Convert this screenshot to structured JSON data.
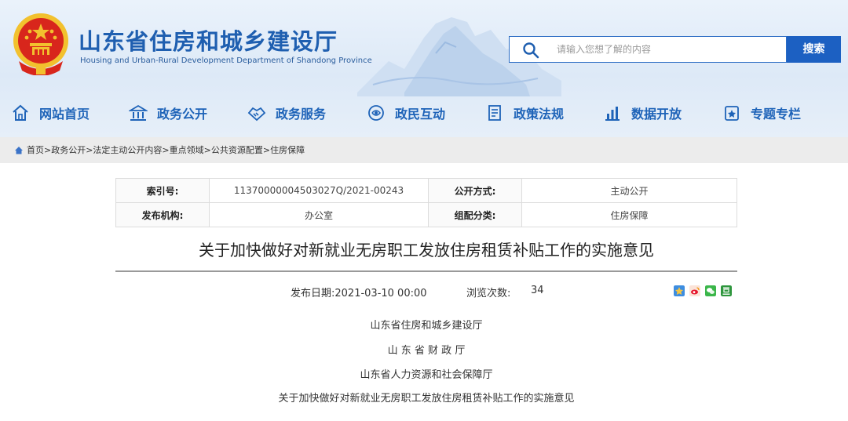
{
  "site": {
    "title_cn": "山东省住房和城乡建设厅",
    "title_en": "Housing and Urban-Rural Development Department of Shandong Province"
  },
  "search": {
    "placeholder": "请输入您想了解的内容",
    "button_label": "搜索"
  },
  "nav": {
    "items": [
      {
        "label": "网站首页",
        "icon": "home-icon"
      },
      {
        "label": "政务公开",
        "icon": "government-building-icon"
      },
      {
        "label": "政务服务",
        "icon": "handshake-icon"
      },
      {
        "label": "政民互动",
        "icon": "people-interaction-icon"
      },
      {
        "label": "政策法规",
        "icon": "policy-document-icon"
      },
      {
        "label": "数据开放",
        "icon": "bar-chart-icon"
      },
      {
        "label": "专题专栏",
        "icon": "special-column-icon"
      }
    ]
  },
  "breadcrumb": "首页>政务公开>法定主动公开内容>重点领域>公共资源配置>住房保障",
  "meta": {
    "index_label": "索引号:",
    "index_value": "11370000004503027Q/2021-00243",
    "open_label": "公开方式:",
    "open_value": "主动公开",
    "org_label": "发布机构:",
    "org_value": "办公室",
    "category_label": "组配分类:",
    "category_value": "住房保障"
  },
  "article": {
    "title": "关于加快做好对新就业无房职工发放住房租赁补贴工作的实施意见",
    "pubdate": "发布日期:2021-03-10 00:00",
    "views_label": "浏览次数:",
    "views_count": "34",
    "issuers": [
      "山东省住房和城乡建设厅",
      "山 东 省 财 政 厅",
      "山东省人力资源和社会保障厅"
    ],
    "subtitle": "关于加快做好对新就业无房职工发放住房租赁补贴工作的实施意见"
  },
  "share_icons": [
    "qzone-share-icon",
    "weibo-share-icon",
    "wechat-share-icon",
    "douban-share-icon"
  ],
  "colors": {
    "brand_blue": "#1f5fb0",
    "search_button": "#1c60c2",
    "emblem_red": "#d8261c",
    "emblem_gold": "#f2c12e"
  }
}
